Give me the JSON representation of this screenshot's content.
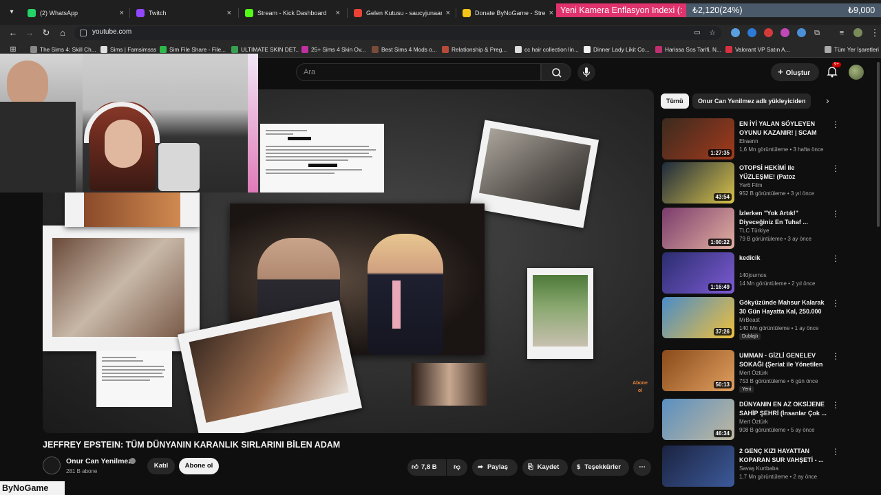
{
  "browser": {
    "tabs": [
      {
        "title": "(2) WhatsApp",
        "color": "#25d366"
      },
      {
        "title": "Twitch",
        "color": "#9146ff"
      },
      {
        "title": "Stream - Kick Dashboard",
        "color": "#53fc18"
      },
      {
        "title": "Gelen Kutusu - saucyjunaar@g",
        "color": "#ea4335"
      },
      {
        "title": "Donate ByNoGame - Streamer",
        "color": "#f5c518"
      }
    ],
    "url": "youtube.com",
    "bookmarks": [
      "The Sims 4: Skill Ch...",
      "Sims | Famsimsss",
      "Sim File Share - File...",
      "ULTIMATE SKIN DET...",
      "25+ Sims 4 Skin Ov...",
      "Best Sims 4 Mods o...",
      "Relationship & Preg...",
      "cc hair collection lin...",
      "Dinner Lady Likit Co...",
      "Harissa Sos Tarifi, N...",
      "Valorant VP Satın A...",
      "Tüm Yer İşaretleri"
    ]
  },
  "ticker": {
    "label": "Yeni Kamera Enflasyon Indexi (:",
    "value1": "₺2,120(24%)",
    "value2": "₺9,000"
  },
  "youtube": {
    "search_placeholder": "Ara",
    "create_label": "Oluştur",
    "notif_badge": "9+",
    "video": {
      "title": "JEFFREY EPSTEIN: TÜM DÜNYANIN KARANLIK SIRLARINI BİLEN ADAM",
      "channel": "Onur Can Yenilmez",
      "subs": "281 B abone",
      "join_label": "Katıl",
      "subscribe_label": "Abone ol",
      "likes": "7,8 B",
      "share_label": "Paylaş",
      "save_label": "Kaydet",
      "thanks_label": "Teşekkürler",
      "watermark": "Abone ol"
    },
    "chips": [
      "Tümü",
      "Onur Can Yenilmez adlı yükleyiciden"
    ],
    "recommendations": [
      {
        "title": "EN İYİ YALAN SÖYLEYEN OYUNU KAZANIR! | SCAM LI...",
        "channel": "Elraenn",
        "meta": "1,6 Mn görüntüleme • 3 hafta önce",
        "duration": "1:27:35",
        "c1": "#3b2a1f",
        "c2": "#a33a1c"
      },
      {
        "title": "OTOPSİ HEKİMİ ile YÜZLEŞME! (Patoz Makinesinden Geçmiş...",
        "channel": "Yer6 Film",
        "meta": "952 B görüntüleme • 3 yıl önce",
        "duration": "43:54",
        "c1": "#1d2a3c",
        "c2": "#d8c24a"
      },
      {
        "title": "İzlerken \"Yok Artık!\" Diyeceğiniz En Tuhaf ...",
        "channel": "TLC Türkiye",
        "meta": "79 B görüntüleme • 3 ay önce",
        "duration": "1:00:22",
        "c1": "#7a3b6c",
        "c2": "#e2b0a0"
      },
      {
        "title": "kedicik",
        "channel": "140journos",
        "meta": "14 Mn görüntüleme • 2 yıl önce",
        "duration": "1:16:49",
        "c1": "#2a2d6e",
        "c2": "#7d5bd4"
      },
      {
        "title": "Gökyüzünde Mahsur Kalarak 30 Gün Hayatta Kal, 250.000 ...",
        "channel": "MrBeast",
        "meta": "140 Mn görüntüleme • 1 ay önce",
        "duration": "37:26",
        "badge": "Dublajlı",
        "c1": "#4a8cc9",
        "c2": "#f0c03a"
      },
      {
        "title": "UMMAN - GİZLİ GENELEV SOKAĞI (Şeriat ile Yönetilen ...",
        "channel": "Mert Öztürk",
        "meta": "753 B görüntüleme • 6 gün önce",
        "duration": "50:13",
        "badge": "Yeni",
        "c1": "#8a4a1a",
        "c2": "#e0a060"
      },
      {
        "title": "DÜNYANIN EN AZ OKSİJENE SAHİP ŞEHRİ (İnsanlar Çok ...",
        "channel": "Mert Öztürk",
        "meta": "908 B görüntüleme • 5 ay önce",
        "duration": "46:34",
        "c1": "#5a8fc0",
        "c2": "#c0b8a0"
      },
      {
        "title": "2 GENÇ KIZI HAYATTAN KOPARAN SUR VAHŞETİ - ...",
        "channel": "Savaş Kurtbaba",
        "meta": "1,7 Mn görüntüleme • 2 ay önce",
        "duration": "",
        "c1": "#1b2340",
        "c2": "#3c5a9a"
      }
    ]
  },
  "overlay": {
    "brand": "ByNoGame"
  }
}
